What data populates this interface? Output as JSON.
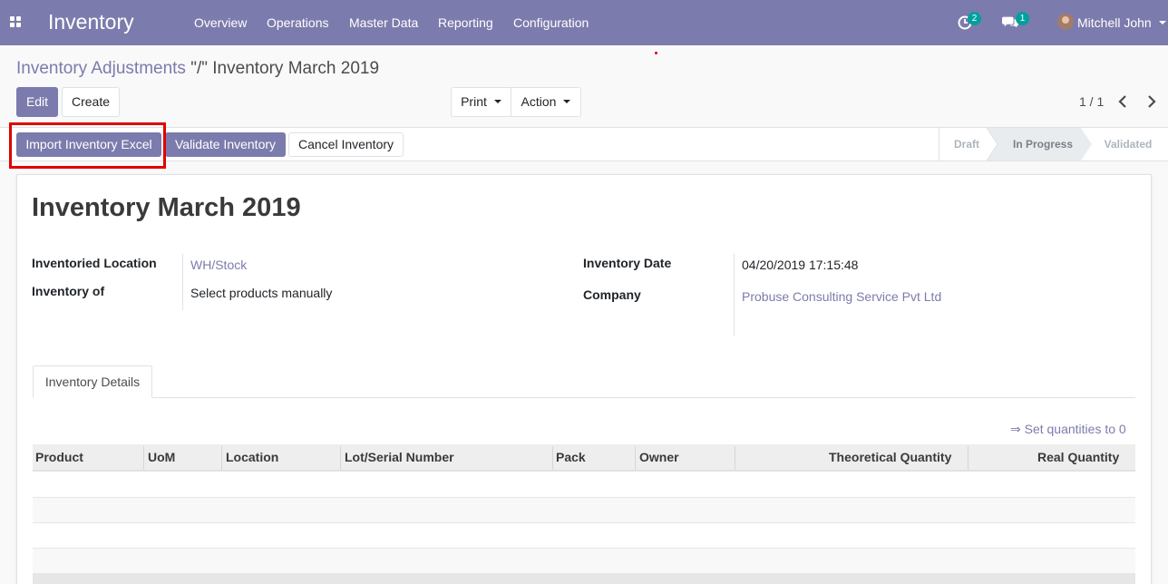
{
  "navbar": {
    "app_title": "Inventory",
    "menu": [
      "Overview",
      "Operations",
      "Master Data",
      "Reporting",
      "Configuration"
    ],
    "activity_count": "2",
    "messages_count": "1",
    "user_name": "Mitchell John",
    "icons": [
      "apps-grid-icon",
      "activity-clock-icon",
      "chat-bubbles-icon",
      "user-avatar"
    ]
  },
  "breadcrumb": {
    "parent": "Inventory Adjustments",
    "separator": "\"/\"",
    "current": "Inventory March 2019"
  },
  "toolbar": {
    "edit_label": "Edit",
    "create_label": "Create",
    "print_label": "Print",
    "action_label": "Action",
    "pager": "1 / 1"
  },
  "statusbar": {
    "buttons": [
      "Import Inventory Excel",
      "Validate Inventory",
      "Cancel Inventory"
    ],
    "stages": [
      "Draft",
      "In Progress",
      "Validated"
    ],
    "active_stage": "In Progress"
  },
  "form": {
    "title": "Inventory March 2019",
    "fields_left": [
      {
        "label": "Inventoried Location",
        "value": "WH/Stock"
      },
      {
        "label": "Inventory of",
        "value": "Select products manually"
      }
    ],
    "fields_right": [
      {
        "label": "Inventory Date",
        "value": "04/20/2019 17:15:48"
      },
      {
        "label": "Company",
        "value": "Probuse Consulting Service Pvt Ltd"
      }
    ]
  },
  "tabs": [
    "Inventory Details"
  ],
  "set_quantities_link": "⇒ Set quantities to 0",
  "table": {
    "columns": [
      "Product",
      "UoM",
      "Location",
      "Lot/Serial Number",
      "Pack",
      "Owner",
      "Theoretical Quantity",
      "Real Quantity"
    ],
    "rows": []
  },
  "colors": {
    "brand": "#7c7bad",
    "highlight": "#e00000",
    "badge": "#00a09d"
  }
}
